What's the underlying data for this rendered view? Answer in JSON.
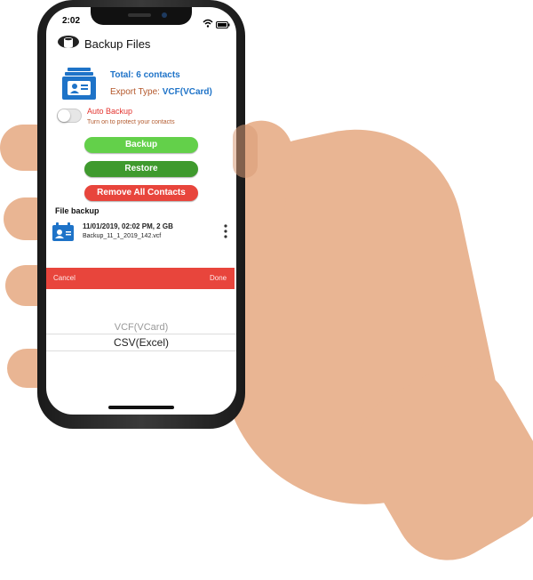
{
  "status_bar": {
    "time": "2:02"
  },
  "header": {
    "title": "Backup Files"
  },
  "summary": {
    "total": "Total: 6 contacts",
    "export_label": "Export Type:",
    "export_value": "VCF(VCard)"
  },
  "auto_backup": {
    "label": "Auto Backup",
    "subtitle": "Turn on to protect your contacts",
    "enabled": false
  },
  "buttons": {
    "backup": "Backup",
    "restore": "Restore",
    "remove_all": "Remove All Contacts"
  },
  "file_backup": {
    "section_title": "File backup",
    "items": [
      {
        "date": "11/01/2019, 02:02 PM, 2 GB",
        "name": "Backup_11_1_2019_142.vcf"
      }
    ]
  },
  "picker": {
    "cancel": "Cancel",
    "done": "Done",
    "options": [
      "VCF(VCard)",
      "CSV(Excel)"
    ],
    "selected": "CSV(Excel)"
  },
  "colors": {
    "blue": "#1e73c8",
    "green_light": "#63d04a",
    "green_dark": "#3f9a2e",
    "red": "#e8453c",
    "skin": "#e9b593"
  }
}
